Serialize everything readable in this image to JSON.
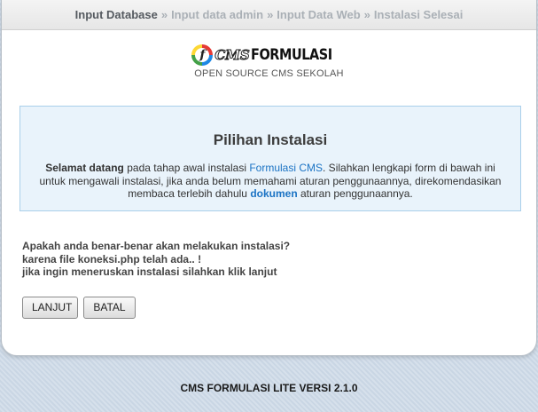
{
  "breadcrumb": {
    "steps": [
      "Input Database",
      "Input data admin",
      "Input Data Web",
      "Instalasi Selesai"
    ],
    "separator": "»"
  },
  "logo": {
    "badge_letter": "f",
    "cms": "CMS",
    "brand": "FORMULASI",
    "subtitle": "OPEN SOURCE CMS SEKOLAH"
  },
  "info": {
    "title": "Pilihan Instalasi",
    "p_bold": "Selamat datang",
    "p_1": " pada tahap awal instalasi ",
    "p_link": "Formulasi CMS",
    "p_2": ". Silahkan lengkapi form di bawah ini untuk mengawali instalasi, jika anda belum memahami aturan penggunaannya, direkomendasikan membaca terlebih dahulu ",
    "p_link2": "dokumen",
    "p_3": " aturan penggunaannya."
  },
  "question": {
    "line1": "Apakah anda benar-benar akan melakukan instalasi?",
    "line2": "karena file koneksi.php telah ada.. !",
    "line3": "jika ingin meneruskan instalasi silahkan klik lanjut"
  },
  "buttons": {
    "next": "LANJUT",
    "cancel": "BATAL"
  },
  "footer": {
    "text": "CMS FORMULASI LITE VERSI 2.1.0"
  },
  "colors": {
    "link": "#1b73c4",
    "info_bg": "#e9f3fb",
    "info_border": "#a9cfea"
  }
}
